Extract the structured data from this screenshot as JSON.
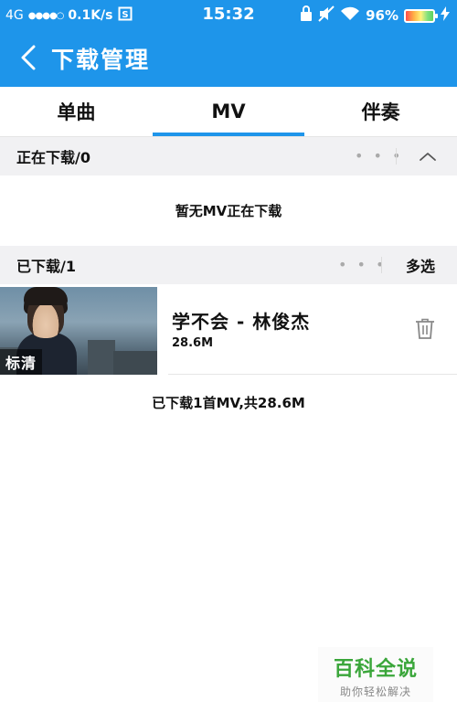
{
  "status_bar": {
    "network": "4G",
    "signal": "●●●●○",
    "speed": "0.1K/s",
    "time": "15:32",
    "battery": "96%"
  },
  "header": {
    "title": "下载管理"
  },
  "tabs": [
    {
      "label": "单曲",
      "active": false
    },
    {
      "label": "MV",
      "active": true
    },
    {
      "label": "伴奏",
      "active": false
    }
  ],
  "downloading": {
    "title": "正在下载/0",
    "empty_message": "暂无MV正在下载"
  },
  "downloaded": {
    "title": "已下载/1",
    "multiselect_label": "多选",
    "items": [
      {
        "title": "学不会 - 林俊杰",
        "size": "28.6M",
        "quality": "标清"
      }
    ],
    "summary": "已下载1首MV,共28.6M"
  },
  "watermark": {
    "title": "百科全说",
    "subtitle": "助你轻松解决"
  },
  "colors": {
    "brand_blue": "#1e95ea",
    "section_bg": "#f1f1f3"
  }
}
